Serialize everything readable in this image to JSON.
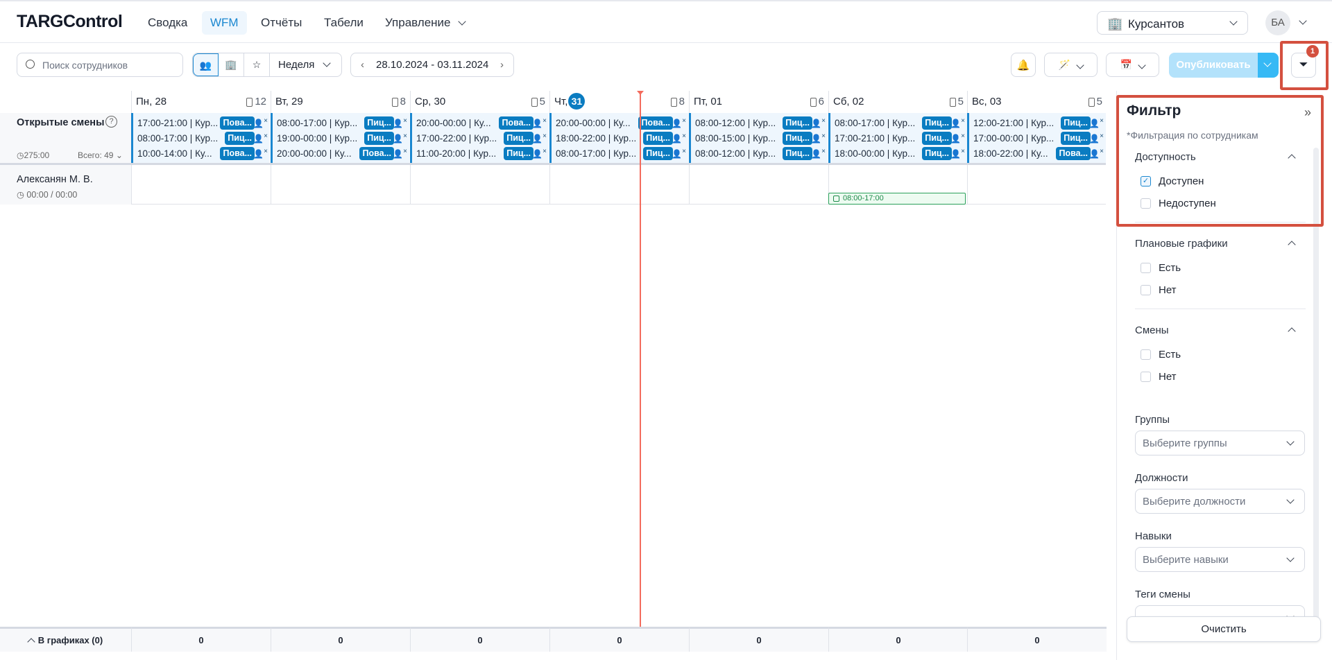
{
  "app": {
    "logo": "TARGControl",
    "nav": [
      {
        "label": "Сводка"
      },
      {
        "label": "WFM",
        "active": true
      },
      {
        "label": "Отчёты"
      },
      {
        "label": "Табели"
      },
      {
        "label": "Управление"
      }
    ],
    "location": "Курсантов",
    "avatar": "БА"
  },
  "toolbar": {
    "search_placeholder": "Поиск сотрудников",
    "view": "Неделя",
    "date_range": "28.10.2024 - 03.11.2024",
    "publish": "Опубликовать",
    "filter_badge": "1"
  },
  "colors": {
    "accent": "#1a87d0",
    "tag": "#0a7cc1",
    "now_line": "#f36b5c",
    "highlight": "#d4503f",
    "publish_disabled": "#b3e2fb"
  },
  "grid": {
    "open_shifts": {
      "label": "Открытые смены",
      "hours": "275:00",
      "total": "Всего: 49"
    },
    "days": [
      {
        "label": "Пн, 28",
        "count": "12",
        "shifts": [
          {
            "text": "17:00-21:00 | Кур...",
            "tag": "Пова..."
          },
          {
            "text": "08:00-17:00 | Кур...",
            "tag": "Пиц..."
          },
          {
            "text": "10:00-14:00 | Ку...",
            "tag": "Пова..."
          }
        ]
      },
      {
        "label": "Вт, 29",
        "count": "8",
        "shifts": [
          {
            "text": "08:00-17:00 | Кур...",
            "tag": "Пиц..."
          },
          {
            "text": "19:00-00:00 | Кур...",
            "tag": "Пиц..."
          },
          {
            "text": "20:00-00:00 | Ку...",
            "tag": "Пова..."
          }
        ]
      },
      {
        "label": "Ср, 30",
        "count": "5",
        "shifts": [
          {
            "text": "20:00-00:00 | Ку...",
            "tag": "Пова..."
          },
          {
            "text": "17:00-22:00 | Кур...",
            "tag": "Пиц..."
          },
          {
            "text": "11:00-20:00 | Кур...",
            "tag": "Пиц..."
          }
        ]
      },
      {
        "label": "Чт,",
        "day_badge": "31",
        "today": true,
        "count": "8",
        "shifts": [
          {
            "text": "20:00-00:00 | Ку...",
            "tag": "Пова..."
          },
          {
            "text": "18:00-22:00 | Кур...",
            "tag": "Пиц..."
          },
          {
            "text": "08:00-17:00 | Кур...",
            "tag": "Пиц..."
          }
        ]
      },
      {
        "label": "Пт, 01",
        "count": "6",
        "shifts": [
          {
            "text": "08:00-12:00 | Кур...",
            "tag": "Пиц..."
          },
          {
            "text": "08:00-15:00 | Кур...",
            "tag": "Пиц..."
          },
          {
            "text": "08:00-12:00 | Кур...",
            "tag": "Пиц..."
          }
        ]
      },
      {
        "label": "Сб, 02",
        "count": "5",
        "shifts": [
          {
            "text": "08:00-17:00 | Кур...",
            "tag": "Пиц..."
          },
          {
            "text": "17:00-21:00 | Кур...",
            "tag": "Пиц..."
          },
          {
            "text": "18:00-00:00 | Кур...",
            "tag": "Пиц..."
          }
        ]
      },
      {
        "label": "Вс, 03",
        "count": "5",
        "shifts": [
          {
            "text": "12:00-21:00 | Кур...",
            "tag": "Пиц..."
          },
          {
            "text": "17:00-00:00 | Кур...",
            "tag": "Пиц..."
          },
          {
            "text": "18:00-22:00 | Ку...",
            "tag": "Пова..."
          }
        ]
      }
    ],
    "employees": [
      {
        "name": "Алексанян М. В.",
        "hours": "00:00 / 00:00",
        "plans": [
          {
            "day": 5,
            "text": "08:00-17:00"
          }
        ]
      }
    ],
    "footer": {
      "label": "В графиках (0)",
      "values": [
        "0",
        "0",
        "0",
        "0",
        "0",
        "0",
        "0"
      ]
    }
  },
  "filter": {
    "title": "Фильтр",
    "subtitle": "*Фильтрация по сотрудникам",
    "sections": [
      {
        "title": "Доступность",
        "options": [
          {
            "label": "Доступен",
            "checked": true
          },
          {
            "label": "Недоступен",
            "checked": false
          }
        ]
      },
      {
        "title": "Плановые графики",
        "options": [
          {
            "label": "Есть",
            "checked": false
          },
          {
            "label": "Нет",
            "checked": false
          }
        ]
      },
      {
        "title": "Смены",
        "options": [
          {
            "label": "Есть",
            "checked": false
          },
          {
            "label": "Нет",
            "checked": false
          }
        ]
      }
    ],
    "selects": [
      {
        "label": "Группы",
        "placeholder": "Выберите группы"
      },
      {
        "label": "Должности",
        "placeholder": "Выберите должности"
      },
      {
        "label": "Навыки",
        "placeholder": "Выберите навыки"
      },
      {
        "label": "Теги смены",
        "placeholder": ""
      }
    ],
    "clear": "Очистить"
  }
}
